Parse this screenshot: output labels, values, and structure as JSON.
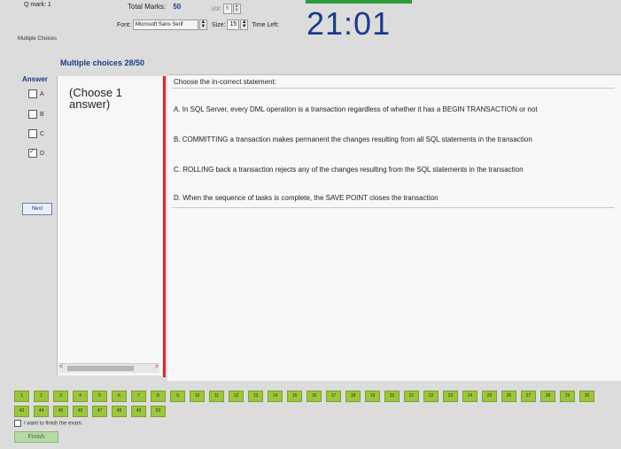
{
  "header": {
    "mark_label": "Q mark: 1",
    "total_marks_label": "Total Marks:",
    "total_marks_value": "50",
    "vol_label": "Vol:",
    "vol_value": "8",
    "font_label": "Font:",
    "font_value": "Microsoft Sans Serif",
    "size_label": "Size:",
    "size_value": "15",
    "time_left_label": "Time Left:",
    "timer_value": "21:01",
    "accent_color": "#1a3a8c",
    "top_bar_color": "#2e9b3a"
  },
  "tab": {
    "label": "Multiple Choices"
  },
  "section": {
    "title": "Multiple choices 28/50"
  },
  "answer_panel": {
    "title": "Answer",
    "options": [
      {
        "label": "A",
        "checked": false
      },
      {
        "label": "B",
        "checked": false
      },
      {
        "label": "C",
        "checked": false
      },
      {
        "label": "D",
        "checked": true
      }
    ],
    "next_label": "Next"
  },
  "choose_pane": {
    "text": "(Choose 1 answer)"
  },
  "question": {
    "stem": "Choose the in-correct statement:",
    "options": [
      "A. In SQL Server, every DML operation is a transaction regardless of whether it has a BEGIN TRANSACTION or not",
      "B. COMMITTING a transaction makes permanent the changes resulting from all SQL statements in the transaction",
      "C. ROLLING back a transaction rejects any of the changes resulting from the SQL statements in the transaction",
      "D. When the sequence of tasks is complete, the SAVE POINT closes the transaction"
    ],
    "divider_color": "#d32f2f"
  },
  "question_nav": {
    "row1": [
      "1",
      "2",
      "3",
      "4",
      "5",
      "6",
      "7",
      "8",
      "9",
      "10",
      "11",
      "12",
      "13",
      "14",
      "15",
      "16",
      "17",
      "18",
      "19",
      "20",
      "21",
      "22",
      "23",
      "24",
      "25",
      "26",
      "27",
      "28",
      "29",
      "30"
    ],
    "row2": [
      "43",
      "44",
      "45",
      "46",
      "47",
      "48",
      "49",
      "50"
    ],
    "button_color": "#9bc53d"
  },
  "footer": {
    "finish_checkbox_label": "I want to finish the exam.",
    "finish_button_label": "Finish"
  }
}
